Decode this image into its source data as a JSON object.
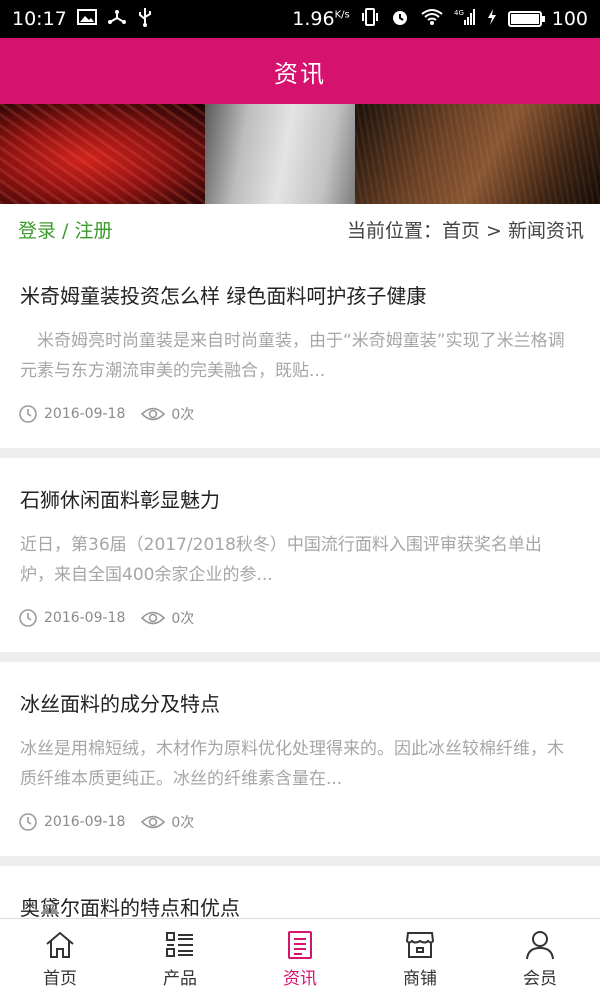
{
  "status_bar": {
    "time": "10:17",
    "speed": "1.96",
    "speed_unit": "K/s",
    "network": "4G",
    "battery": "100",
    "battery_level": 1.0
  },
  "header": {
    "title": "资讯"
  },
  "nav": {
    "login_label": "登录 / 注册",
    "location_label": "当前位置：首页 > 新闻资讯"
  },
  "articles": [
    {
      "title": "米奇姆童装投资怎么样 绿色面料呵护孩子健康",
      "summary": "　米奇姆亮时尚童装是来自时尚童装，由于“米奇姆童装”实现了米兰格调元素与东方潮流审美的完美融合，既贴...",
      "date": "2016-09-18",
      "views": "0次"
    },
    {
      "title": "石狮休闲面料彰显魅力",
      "summary": "近日，第36届（2017/2018秋冬）中国流行面料入围评审获奖名单出炉，来自全国400余家企业的参...",
      "date": "2016-09-18",
      "views": "0次"
    },
    {
      "title": "冰丝面料的成分及特点",
      "summary": "冰丝是用棉短绒，木材作为原料优化处理得来的。因此冰丝较棉纤维，木质纤维本质更纯正。冰丝的纤维素含量在...",
      "date": "2016-09-18",
      "views": "0次"
    },
    {
      "title": "奥黛尔面料的特点和优点"
    }
  ],
  "tabs": [
    {
      "label": "首页",
      "icon": "home-icon"
    },
    {
      "label": "产品",
      "icon": "list-icon"
    },
    {
      "label": "资讯",
      "icon": "news-icon",
      "active": true
    },
    {
      "label": "商铺",
      "icon": "store-icon"
    },
    {
      "label": "会员",
      "icon": "user-icon"
    }
  ],
  "colors": {
    "brand": "#d6126f",
    "login_link": "#3c9a2c"
  }
}
